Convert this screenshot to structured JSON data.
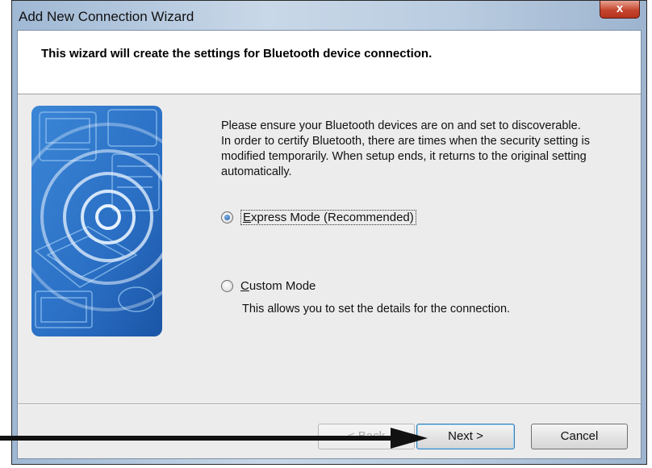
{
  "window": {
    "title": "Add New Connection Wizard",
    "close_glyph": "x"
  },
  "header": {
    "text": "This wizard will create the settings for Bluetooth device connection."
  },
  "content": {
    "line1": "Please ensure your Bluetooth devices are on and set to discoverable.",
    "line2": "In order to certify Bluetooth, there are times when the security setting is modified temporarily. When setup ends, it returns to the original setting automatically."
  },
  "options": {
    "express": {
      "access_key": "E",
      "label_rest": "xpress Mode (Recommended)",
      "checked": true
    },
    "custom": {
      "access_key": "C",
      "label_rest": "ustom Mode",
      "checked": false,
      "description": "This allows you to set the details for the connection."
    }
  },
  "buttons": {
    "back": {
      "label": "< Back",
      "enabled": false
    },
    "next": {
      "label": "Next >"
    },
    "cancel": {
      "label": "Cancel"
    }
  },
  "colors": {
    "accent": "#3c7fb1",
    "image_blue": "#2a6fc4",
    "close_red": "#c5452e"
  },
  "icons": {
    "illustration": "bluetooth-office-devices-illustration",
    "annotation": "pointer-arrow"
  }
}
